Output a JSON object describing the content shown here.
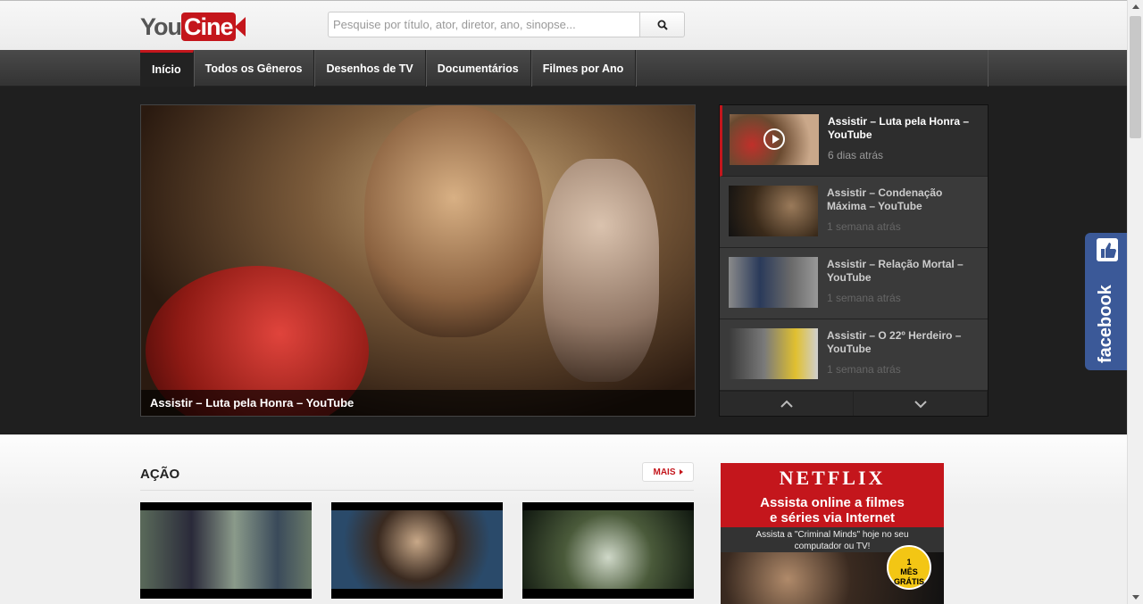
{
  "header": {
    "logo_you": "You",
    "logo_cine": "Cine",
    "search_placeholder": "Pesquise por título, ator, diretor, ano, sinopse..."
  },
  "nav": {
    "items": [
      {
        "label": "Início",
        "active": true
      },
      {
        "label": "Todos os Gêneros"
      },
      {
        "label": "Desenhos de TV"
      },
      {
        "label": "Documentários"
      },
      {
        "label": "Filmes por Ano"
      }
    ]
  },
  "featured": {
    "main_caption": "Assistir – Luta pela Honra – YouTube",
    "list": [
      {
        "title": "Assistir – Luta pela Honra – YouTube",
        "time": "6 dias atrás"
      },
      {
        "title": "Assistir – Condenação Máxima – YouTube",
        "time": "1 semana atrás"
      },
      {
        "title": "Assistir – Relação Mortal – YouTube",
        "time": "1 semana atrás"
      },
      {
        "title": "Assistir – O 22º Herdeiro – YouTube",
        "time": "1 semana atrás"
      }
    ]
  },
  "section": {
    "title": "AÇÃO",
    "more_label": "MAIS"
  },
  "ad": {
    "brand": "NETFLIX",
    "headline_1": "Assista online a filmes",
    "headline_2": "e séries via Internet",
    "sub_1": "Assista a \"Criminal Minds\" hoje no seu",
    "sub_2": "computador ou TV!",
    "badge_1": "1",
    "badge_2": "MÊS",
    "badge_3": "GRÁTIS"
  },
  "facebook_tab": "facebook",
  "colors": {
    "accent": "#c4161c",
    "facebook": "#3b5998"
  }
}
